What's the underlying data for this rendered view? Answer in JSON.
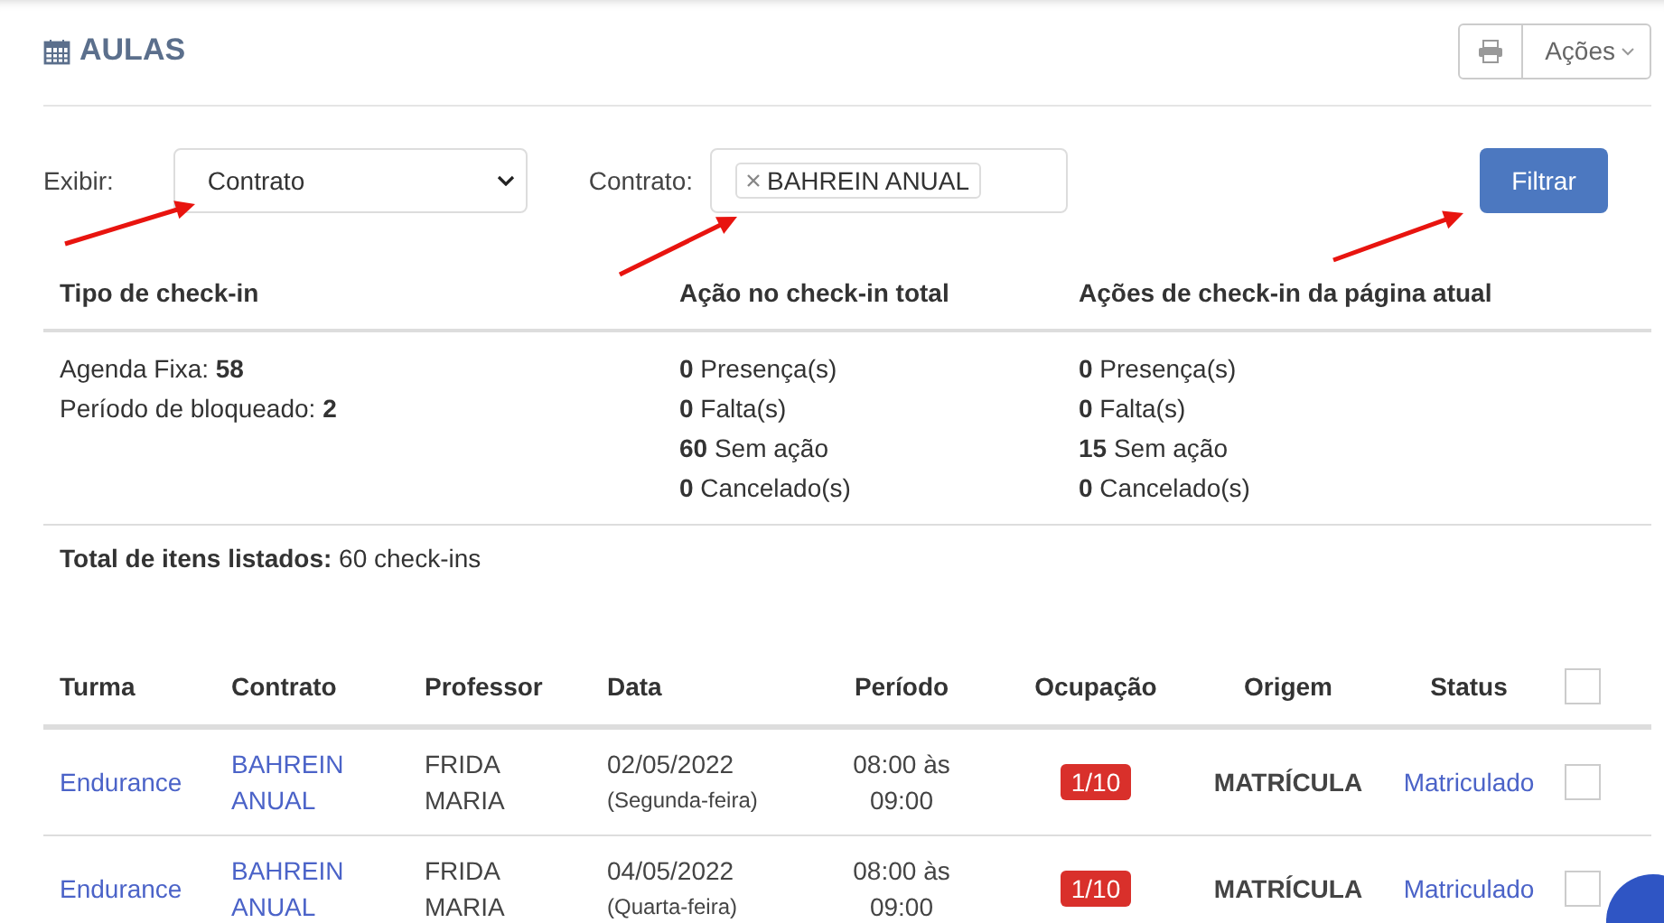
{
  "header": {
    "title": "AULAS",
    "actions_label": "Ações"
  },
  "filters": {
    "show_label": "Exibir:",
    "show_value": "Contrato",
    "contract_label": "Contrato:",
    "contract_tags": [
      "BAHREIN ANUAL"
    ],
    "submit": "Filtrar"
  },
  "summary": {
    "columns": [
      {
        "heading": "Tipo de check-in",
        "lines": [
          "Agenda Fixa: **58**",
          "Período de bloqueado: **2**"
        ]
      },
      {
        "heading": "Ação no check-in total",
        "lines": [
          "**0** Presença(s)",
          "**0** Falta(s)",
          "**60** Sem ação",
          "**0** Cancelado(s)"
        ]
      },
      {
        "heading": "Ações de check-in da página atual",
        "lines": [
          "**0** Presença(s)",
          "**0** Falta(s)",
          "**15** Sem ação",
          "**0** Cancelado(s)"
        ]
      }
    ],
    "total": "**Total de itens listados:** 60 check-ins"
  },
  "table": {
    "columns": [
      "Turma",
      "Contrato",
      "Professor",
      "Data",
      "Período",
      "Ocupação",
      "Origem",
      "Status"
    ],
    "select_all_checked": false,
    "rows": [
      {
        "turma": "Endurance",
        "contrato": [
          "BAHREIN",
          "ANUAL"
        ],
        "professor": [
          "FRIDA",
          "MARIA"
        ],
        "data": "02/05/2022",
        "weekday": "(Segunda-feira)",
        "periodo": [
          "08:00 às",
          "09:00"
        ],
        "ocupacao": "1/10",
        "origem": "MATRÍCULA",
        "status": "Matriculado",
        "checked": false
      },
      {
        "turma": "Endurance",
        "contrato": [
          "BAHREIN",
          "ANUAL"
        ],
        "professor": [
          "FRIDA",
          "MARIA"
        ],
        "data": "04/05/2022",
        "weekday": "(Quarta-feira)",
        "periodo": [
          "08:00 às",
          "09:00"
        ],
        "ocupacao": "1/10",
        "origem": "MATRÍCULA",
        "status": "Matriculado",
        "checked": false
      }
    ]
  }
}
